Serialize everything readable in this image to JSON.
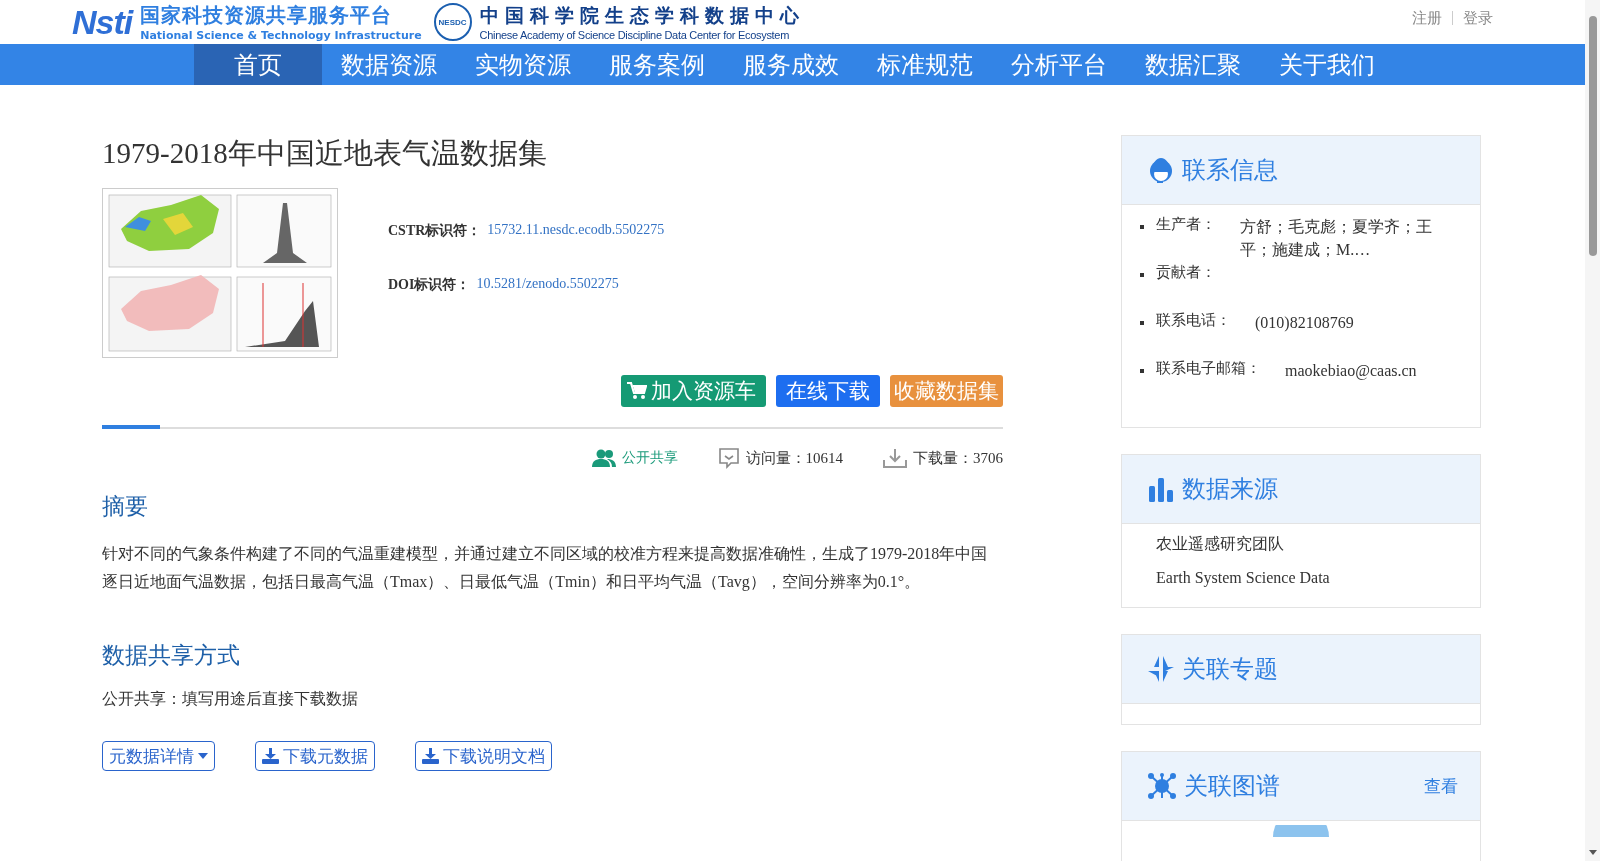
{
  "header": {
    "logo_mark": "Nsti",
    "platform_name": "国家科技资源共享服务平台",
    "platform_name_en": "National Science & Technology Infrastructure",
    "center_badge": "NESDC",
    "center_name": "中国科学院生态学科数据中心",
    "center_name_en": "Chinese Academy of Science Discipline Data Center for Ecosystem",
    "links": [
      "注册",
      "登录"
    ]
  },
  "nav": [
    {
      "label": "首页",
      "selected": true
    },
    {
      "label": "数据资源",
      "selected": false
    },
    {
      "label": "实物资源",
      "selected": false
    },
    {
      "label": "服务案例",
      "selected": false
    },
    {
      "label": "服务成效",
      "selected": false
    },
    {
      "label": "标准规范",
      "selected": false
    },
    {
      "label": "分析平台",
      "selected": false
    },
    {
      "label": "数据汇聚",
      "selected": false
    },
    {
      "label": "关于我们",
      "selected": false
    }
  ],
  "dataset": {
    "title": "1979-2018年中国近地表气温数据集",
    "identifiers": [
      {
        "label": "CSTR标识符：",
        "value": "15732.11.nesdc.ecodb.5502275"
      },
      {
        "label": "DOI标识符：",
        "value": "10.5281/zenodo.5502275"
      }
    ],
    "actions": [
      {
        "label": "加入资源车",
        "kind": "cart"
      },
      {
        "label": "在线下载",
        "kind": "download"
      },
      {
        "label": "收藏数据集",
        "kind": "favorite"
      }
    ],
    "stats": [
      {
        "kind": "access",
        "label": "公开共享"
      },
      {
        "kind": "visits",
        "label": "访问量：10614"
      },
      {
        "kind": "downloads",
        "label": "下载量：3706"
      }
    ],
    "sections": [
      {
        "heading": "摘要",
        "text": "针对不同的气象条件构建了不同的气温重建模型，并通过建立不同区域的校准方程来提高数据准确性，生成了1979-2018年中国逐日近地面气温数据，包括日最高气温（Tmax）、日最低气温（Tmin）和日平均气温（Tavg），空间分辨率为0.1°。"
      },
      {
        "heading": "数据共享方式",
        "text": "公开共享：填写用途后直接下载数据"
      }
    ],
    "bottom_buttons": [
      {
        "label": "元数据详情",
        "kind": "dropdown"
      },
      {
        "label": "下载元数据",
        "kind": "download"
      },
      {
        "label": "下载说明文档",
        "kind": "download"
      }
    ]
  },
  "sidebar": [
    {
      "kind": "contact",
      "title": "联系信息",
      "items": [
        {
          "label": "生产者：",
          "value": "方舒；毛克彪；夏学齐；王平；施建成；M.…"
        },
        {
          "label": "贡献者："
        },
        {
          "label": "联系电话：",
          "value": "(010)82108769"
        },
        {
          "label": "联系电子邮箱：",
          "value": "maokebiao@caas.cn"
        }
      ]
    },
    {
      "kind": "source",
      "title": "数据来源",
      "lines": [
        "农业遥感研究团队",
        "Earth System Science Data"
      ]
    },
    {
      "kind": "topic",
      "title": "关联专题"
    },
    {
      "kind": "graph",
      "title": "关联图谱",
      "link": "查看"
    }
  ]
}
